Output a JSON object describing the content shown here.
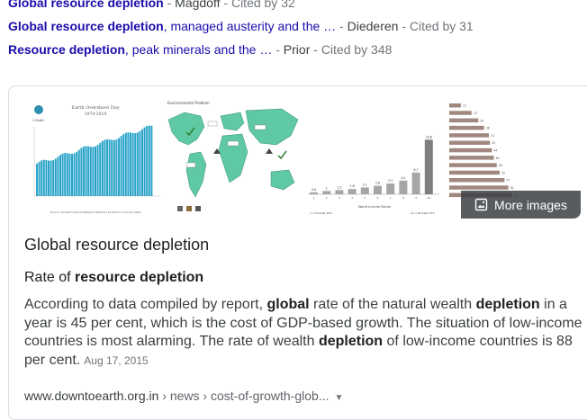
{
  "results": [
    {
      "title_bold": "Global resource depletion",
      "title_rest": "",
      "sep": " - ",
      "author": "Magdoff",
      "cited": "Cited by 32"
    },
    {
      "title_bold": "Global resource depletion",
      "title_rest": ", managed austerity and the …",
      "sep": " - ",
      "author": "Diederen",
      "cited": "Cited by 31"
    },
    {
      "title_bold": "Resource depletion",
      "title_rest": ", peak minerals and the …",
      "sep": " - ",
      "author": "Prior",
      "cited": "Cited by 348"
    }
  ],
  "card": {
    "more_images_label": "More images",
    "title": "Global resource depletion",
    "subtitle_plain": "Rate of ",
    "subtitle_bold": "resource depletion",
    "snippet": {
      "p1": "According to data compiled by report, ",
      "b1": "global",
      "p2": " rate of the natural wealth ",
      "b2": "depletion",
      "p3": " in a year is 45 per cent, which is the cost of GDP-based growth. The situation of low-income countries is most alarming. The rate of wealth ",
      "b3": "depletion",
      "p4": " of low-income countries is 88 per cent."
    },
    "date": "Aug 17, 2015",
    "url_domain": "www.downtoearth.org.in",
    "url_path": " › news › cost-of-growth-glob...",
    "images": {
      "img1": {
        "title": "Earth Overshoot Day",
        "years": "1970-2019",
        "source": "Source: Global Footprint Network National Footprint Accounts 2019"
      },
      "img2": {
        "title": "Environmental Problem"
      },
      "img3": {
        "xlabel": "World Income Decile",
        "left_note": "1 = Poorest 10%",
        "right_note": "10 = Richest 10%",
        "values": [
          0.6,
          1.0,
          1.3,
          1.6,
          2.1,
          2.6,
          3.3,
          4.2,
          6.7,
          16.8
        ]
      },
      "img4": {
        "values": [
          12,
          23,
          30,
          36,
          41,
          42,
          44,
          46,
          49,
          52,
          57,
          61,
          65
        ]
      }
    }
  }
}
